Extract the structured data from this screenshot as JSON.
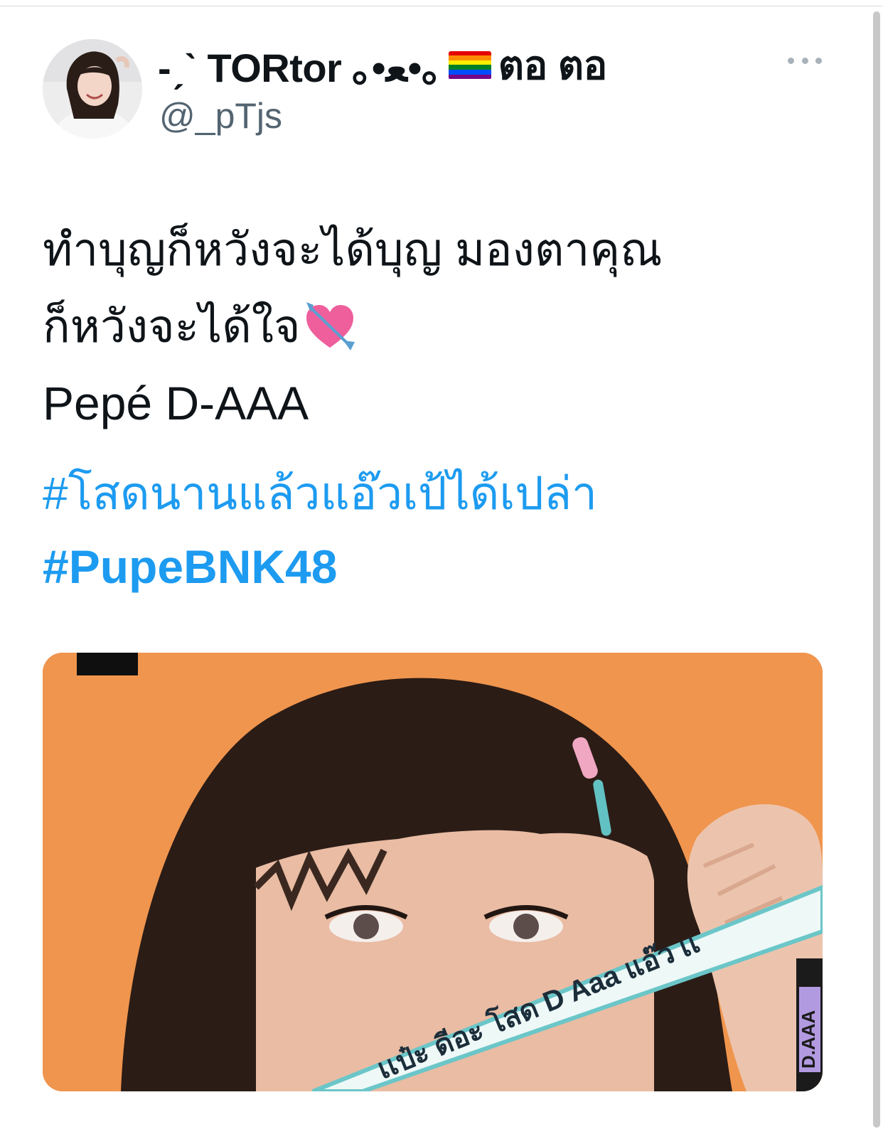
{
  "tweet": {
    "author": {
      "display_name": "-ˏˋ TORtor ｡•ﻌ•｡",
      "display_name_suffix": "ตอ ตอ",
      "handle": "@_pTjs",
      "flag_icon": "rainbow-flag-icon",
      "flag_colors": [
        "#e40303",
        "#ff8c00",
        "#ffed00",
        "#008026",
        "#004dff",
        "#750787"
      ]
    },
    "more_icon": "ellipsis-icon",
    "text_lines": [
      "ทำบุญก็หวังจะได้บุญ มองตาคุณ",
      "ก็หวังจะได้ใจ"
    ],
    "text_emoji_icon": "heart-with-arrow-icon",
    "sub_line": "Pepé D-AAA",
    "hashtags": [
      "#โสดนานแล้วแอ๊วเป้ได้เปล่า",
      "#PupeBNK48"
    ],
    "media": {
      "background_color": "#f0954e",
      "ribbon_text": "เเป๋ะ ดีอะ โสด D Aaa แอ๊ว เเ",
      "side_text": "D.AAA"
    },
    "colors": {
      "link": "#1d9bf0",
      "text": "#0f1419",
      "secondary": "#536471"
    }
  }
}
